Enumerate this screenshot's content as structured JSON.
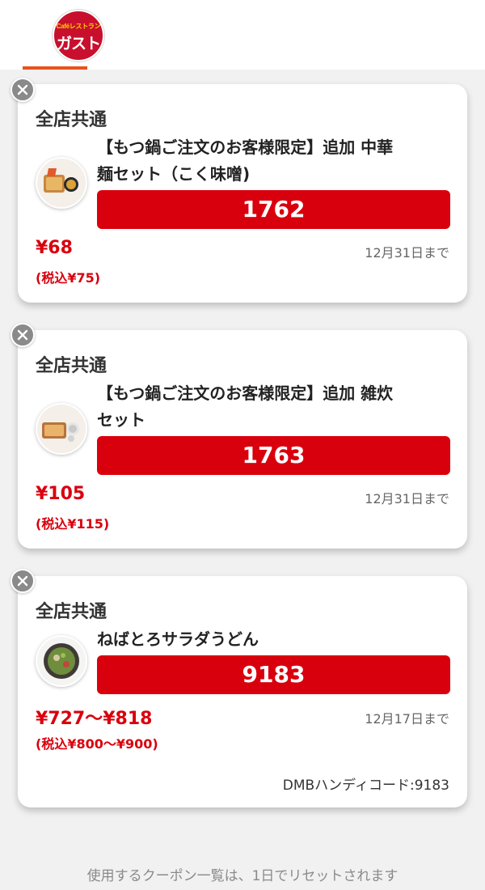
{
  "header": {
    "logo_top": "Caféレストラン",
    "logo_main": "ガスト"
  },
  "coupons": [
    {
      "scope": "全店共通",
      "title_line1": "【もつ鍋ご注文のお客様限定】追加 中華",
      "title_line2": "麺セット（こく味噌)",
      "code": "1762",
      "price": "¥68",
      "price_tax": "(税込¥75)",
      "expiry": "12月31日まで"
    },
    {
      "scope": "全店共通",
      "title_line1": "【もつ鍋ご注文のお客様限定】追加 雑炊",
      "title_line2": "セット",
      "code": "1763",
      "price": "¥105",
      "price_tax": "(税込¥115)",
      "expiry": "12月31日まで"
    },
    {
      "scope": "全店共通",
      "title_line1": "ねばとろサラダうどん",
      "code": "9183",
      "price": "¥727〜¥818",
      "price_tax": "(税込¥800〜¥900)",
      "expiry": "12月17日まで",
      "dmb": "DMBハンディコード:9183"
    }
  ],
  "footer": {
    "note": "使用するクーポン一覧は、1日でリセットされます"
  },
  "colors": {
    "brand_red": "#d9000d",
    "tab_underline": "#e8521c",
    "logo_red": "#c8102e"
  },
  "icons": {
    "close": "close-icon"
  }
}
